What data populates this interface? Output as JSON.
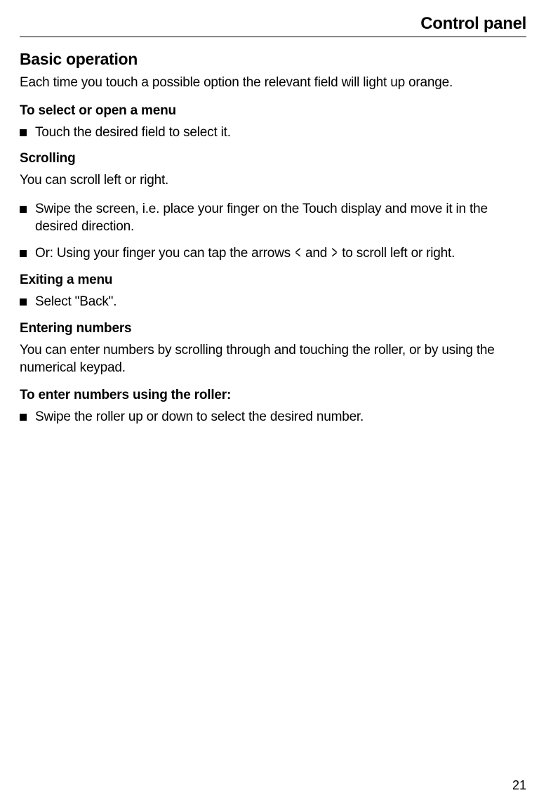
{
  "header": "Control panel",
  "page_number": "21",
  "section_title": "Basic operation",
  "intro_para": "Each time you touch a possible option the relevant field will light up orange.",
  "blocks": [
    {
      "subheading": "To select or open a menu"
    },
    {
      "bullet": "Touch the desired field to select it."
    },
    {
      "subheading": "Scrolling"
    },
    {
      "para": "You can scroll left or right."
    },
    {
      "bullet": "Swipe the screen, i.e. place your finger on the Touch display and move it in the desired direction."
    },
    {
      "bullet_arrows": {
        "pre": "Or: Using your finger you can tap the arrows ",
        "mid": " and ",
        "post": " to scroll left or right."
      }
    },
    {
      "subheading": "Exiting a menu"
    },
    {
      "bullet": "Select \"Back\"."
    },
    {
      "subheading": "Entering numbers"
    },
    {
      "para": "You can enter numbers by scrolling through and touching the roller, or by using the numerical keypad."
    },
    {
      "subheading": "To enter numbers using the roller:"
    },
    {
      "bullet": "Swipe the roller up or down to select the desired number."
    }
  ],
  "arrows": {
    "left": "<",
    "right": ">"
  }
}
